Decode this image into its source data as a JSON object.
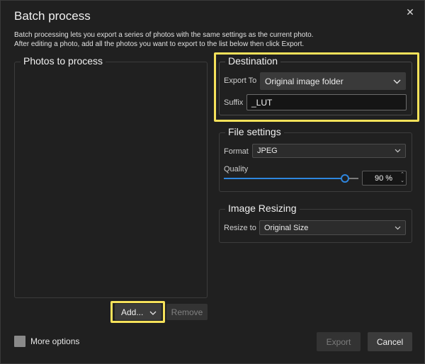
{
  "window": {
    "title": "Batch process",
    "description_line1": "Batch processing lets you export a series of photos with the same settings as the current photo.",
    "description_line2": "After editing a photo, add all the photos you want to export to the list below then click Export."
  },
  "photos": {
    "title": "Photos to process",
    "add_label": "Add...",
    "remove_label": "Remove"
  },
  "destination": {
    "title": "Destination",
    "export_to_label": "Export To",
    "export_to_value": "Original image folder",
    "suffix_label": "Suffix",
    "suffix_value": "_LUT"
  },
  "file_settings": {
    "title": "File settings",
    "format_label": "Format",
    "format_value": "JPEG",
    "quality_label": "Quality",
    "quality_value": "90 %",
    "quality_fraction": 0.9
  },
  "resizing": {
    "title": "Image Resizing",
    "resize_label": "Resize to",
    "resize_value": "Original Size"
  },
  "footer": {
    "more_options_label": "More options",
    "export_label": "Export",
    "cancel_label": "Cancel"
  },
  "colors": {
    "highlight": "#f5e15a",
    "accent": "#2e86de"
  },
  "icons": [
    "close-icon",
    "chevron-down-icon",
    "spin-up-icon",
    "spin-down-icon"
  ]
}
